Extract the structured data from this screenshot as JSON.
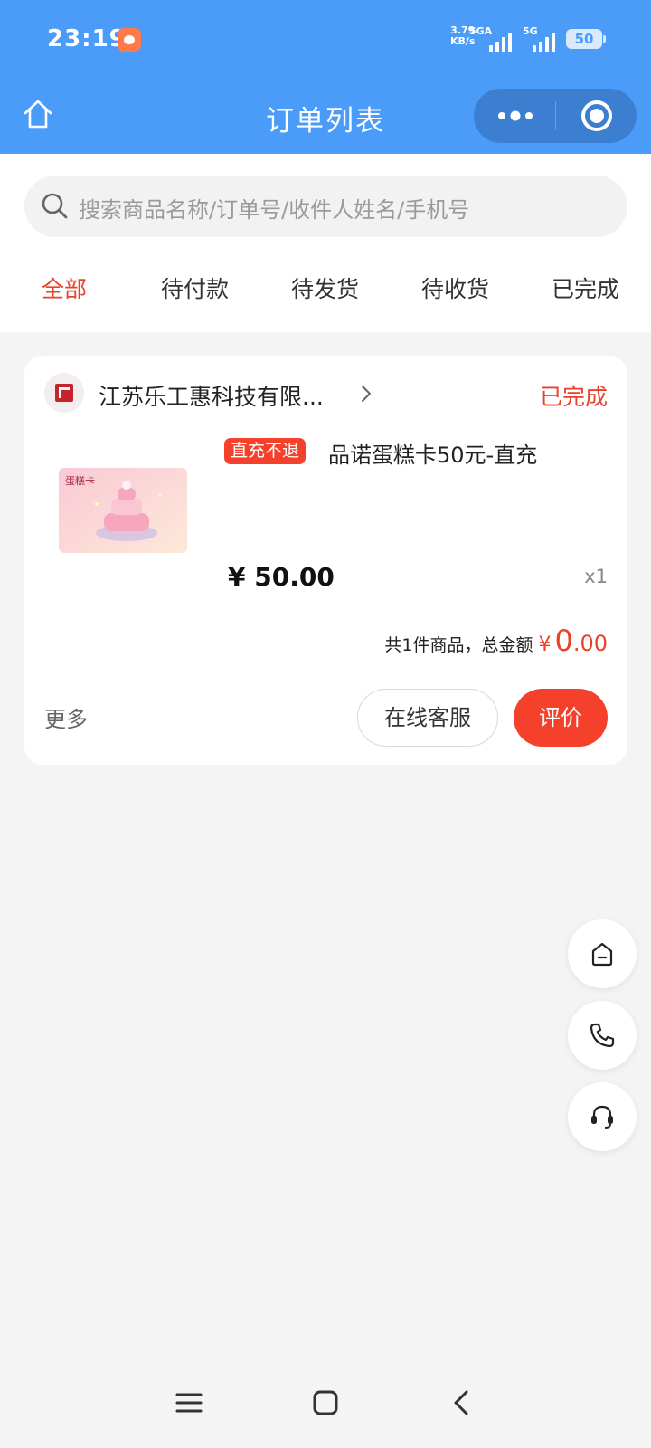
{
  "status_bar": {
    "time": "23:19",
    "net_speed_value": "3.79",
    "net_speed_unit": "KB/s",
    "signal_1_label": "5GA",
    "signal_2_label": "5G",
    "battery": "50"
  },
  "nav": {
    "title": "订单列表"
  },
  "search": {
    "placeholder": "搜索商品名称/订单号/收件人姓名/手机号"
  },
  "tabs": [
    {
      "label": "全部",
      "active": true
    },
    {
      "label": "待付款",
      "active": false
    },
    {
      "label": "待发货",
      "active": false
    },
    {
      "label": "待收货",
      "active": false
    },
    {
      "label": "已完成",
      "active": false
    }
  ],
  "order": {
    "store_name": "江苏乐工惠科技有限...",
    "status": "已完成",
    "product": {
      "tag": "直充不退",
      "name": "品诺蛋糕卡50元-直充",
      "image_text": "蛋糕卡",
      "price": "¥ 50.00",
      "qty": "x1"
    },
    "summary_label": "共1件商品，总金额",
    "total_currency": "¥",
    "total_int": "0",
    "total_dec": ".00",
    "more_label": "更多",
    "service_button": "在线客服",
    "review_button": "评价"
  },
  "floating": {
    "icons": [
      "home-icon",
      "phone-icon",
      "headset-icon"
    ]
  },
  "colors": {
    "header_blue": "#4b9cf8",
    "accent_red": "#e8422d",
    "button_red": "#f5412b",
    "background": "#f4f4f4"
  }
}
